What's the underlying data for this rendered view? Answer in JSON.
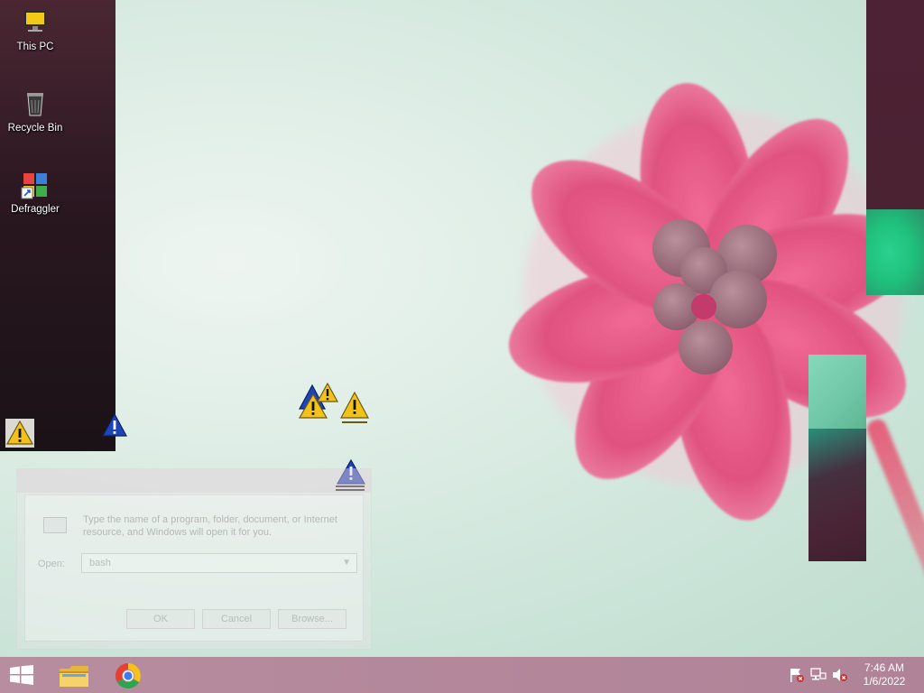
{
  "desktop": {
    "icons": [
      {
        "label": "This PC",
        "icon": "this-pc-icon"
      },
      {
        "label": "Recycle Bin",
        "icon": "recycle-bin-icon"
      },
      {
        "label": "Defraggler",
        "icon": "defraggler-icon"
      }
    ],
    "warning_icons": [
      "warning-icon",
      "shield-warning-icon"
    ]
  },
  "run_dialog": {
    "description": "Type the name of a program, folder, document, or Internet resource, and Windows will open it for you.",
    "open_label": "Open:",
    "open_value": "bash",
    "ok_label": "OK",
    "cancel_label": "Cancel",
    "browse_label": "Browse..."
  },
  "taskbar": {
    "apps": [
      {
        "name": "File Explorer",
        "icon": "file-explorer-icon"
      },
      {
        "name": "Google Chrome",
        "icon": "chrome-icon"
      }
    ],
    "tray": [
      "action-center-flag-icon",
      "network-icon",
      "volume-muted-icon"
    ],
    "clock": {
      "time": "7:46 AM",
      "date": "1/6/2022"
    }
  },
  "colors": {
    "taskbar": "#b4879b",
    "flower": "#e0527f",
    "wallpaper": "#d3e8de"
  }
}
